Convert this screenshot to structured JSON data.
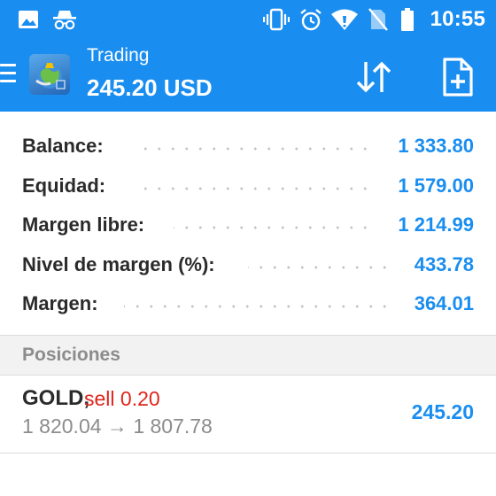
{
  "status_bar": {
    "time": "10:55",
    "left_icons": [
      "image-icon",
      "incognito-icon"
    ],
    "right_icons": [
      "vibrate-icon",
      "alarm-icon",
      "wifi-icon",
      "no-sim-icon",
      "battery-icon"
    ]
  },
  "app_bar": {
    "title": "Trading",
    "amount": "245.20 USD",
    "actions": [
      "sort-icon",
      "new-order-icon"
    ]
  },
  "summary": [
    {
      "label": "Balance:",
      "value": "1 333.80"
    },
    {
      "label": "Equidad:",
      "value": "1 579.00"
    },
    {
      "label": "Margen libre:",
      "value": "1 214.99"
    },
    {
      "label": "Nivel de margen (%):",
      "value": "433.78"
    },
    {
      "label": "Margen:",
      "value": "364.01"
    }
  ],
  "positions_section": {
    "title": "Posiciones"
  },
  "positions": [
    {
      "symbol": "GOLD,",
      "side": "sell 0.20",
      "open_price": "1 820.04",
      "arrow": "→",
      "current_price": "1 807.78",
      "profit": "245.20"
    }
  ],
  "colors": {
    "primary": "#1a8ef0",
    "sell": "#e0241b",
    "muted": "#8c8c8c",
    "text": "#2b2b2b"
  }
}
